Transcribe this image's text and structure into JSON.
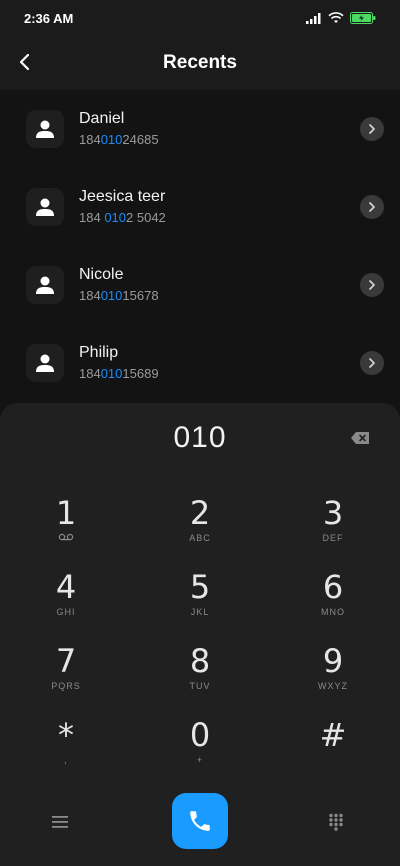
{
  "status_bar": {
    "time": "2:36 AM",
    "icons": [
      "signal-icon",
      "wifi-icon",
      "battery-icon"
    ]
  },
  "header": {
    "title": "Recents",
    "back_icon": "back-arrow-icon"
  },
  "contacts": [
    {
      "name": "Daniel",
      "number_pre": "184",
      "number_match": "010",
      "number_post": "24685"
    },
    {
      "name": "Jeesica teer",
      "number_pre": "184 ",
      "number_match": "010",
      "number_post": "2 5042"
    },
    {
      "name": "Nicole",
      "number_pre": "184",
      "number_match": "010",
      "number_post": "15678"
    },
    {
      "name": "Philip",
      "number_pre": "184",
      "number_match": "010",
      "number_post": "15689"
    }
  ],
  "dialer": {
    "display": "010",
    "keys": [
      {
        "digit": "1",
        "sub": ""
      },
      {
        "digit": "2",
        "sub": "ABC"
      },
      {
        "digit": "3",
        "sub": "DEF"
      },
      {
        "digit": "4",
        "sub": "GHI"
      },
      {
        "digit": "5",
        "sub": "JKL"
      },
      {
        "digit": "6",
        "sub": "MNO"
      },
      {
        "digit": "7",
        "sub": "PQRS"
      },
      {
        "digit": "8",
        "sub": "TUV"
      },
      {
        "digit": "9",
        "sub": "WXYZ"
      },
      {
        "digit": "*",
        "sub": ","
      },
      {
        "digit": "0",
        "sub": "+"
      },
      {
        "digit": "#",
        "sub": ""
      }
    ]
  },
  "colors": {
    "accent": "#1a9bff",
    "highlight": "#1a8cff",
    "background": "#131313",
    "panel": "#202020"
  }
}
